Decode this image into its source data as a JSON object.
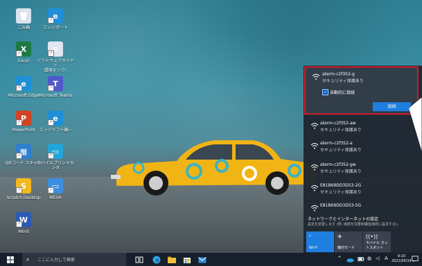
{
  "desktop_icons": [
    {
      "label": "ごみ箱",
      "icon": "recycle-bin-icon"
    },
    {
      "label": "エッジポート",
      "icon": "edge-icon"
    },
    {
      "label": "Excel",
      "icon": "excel-icon"
    },
    {
      "label": "ソフトウェアガイドで\n環境をソク!",
      "icon": "software-guide-icon"
    },
    {
      "label": "Microsoft Edge",
      "icon": "edge-icon"
    },
    {
      "label": "Microsoft Teams",
      "icon": "teams-icon"
    },
    {
      "label": "PowerPoint",
      "icon": "powerpoint-icon"
    },
    {
      "label": "エッジリフト編~",
      "icon": "edge-icon"
    },
    {
      "label": "QRコード スキャン",
      "icon": "qr-scan-icon"
    },
    {
      "label": "モバイルプリントセンタ",
      "icon": "mobile-print-icon"
    },
    {
      "label": "Scratch Desktop",
      "icon": "scratch-icon"
    },
    {
      "label": "MESH",
      "icon": "mesh-icon"
    },
    {
      "label": "Word",
      "icon": "word-icon"
    }
  ],
  "wifi": {
    "selected": {
      "ssid": "aterm-c2f352-g",
      "security": "セキュリティ保護あり",
      "auto_connect_label": "自動的に接続",
      "auto_connect_checked": true,
      "connect_label": "接続"
    },
    "networks": [
      {
        "ssid": "aterm-c2f352-aw",
        "security": "セキュリティ保護あり"
      },
      {
        "ssid": "aterm-c2f352-a",
        "security": "セキュリティ保護あり"
      },
      {
        "ssid": "aterm-c2f352-gw",
        "security": "セキュリティ保護あり"
      },
      {
        "ssid": "E81B69DD3D53-2G",
        "security": "セキュリティ保護あり"
      },
      {
        "ssid": "E81B69DD3D53-5G",
        "security": ""
      }
    ],
    "settings_link": "ネットワークとインターネットの設定",
    "settings_desc": "設定を変更します (例: 接続を従量制課金接続に設定する)。",
    "quick_tiles": [
      {
        "label": "Wi-Fi",
        "icon": "wifi-icon",
        "active": true
      },
      {
        "label": "機内モード",
        "icon": "airplane-icon",
        "active": false
      },
      {
        "label": "モバイル ホットスポット",
        "icon": "hotspot-icon",
        "active": false
      }
    ]
  },
  "taskbar": {
    "search_placeholder": "ここに入力して検索",
    "clock_time": "9:10",
    "clock_date": "2021/05/14",
    "ime": "A"
  },
  "colors": {
    "highlight_border": "#d11b2c",
    "accent": "#1f7fe0",
    "flyout_bg": "#1f2630",
    "taskbar_bg": "#17202a"
  }
}
